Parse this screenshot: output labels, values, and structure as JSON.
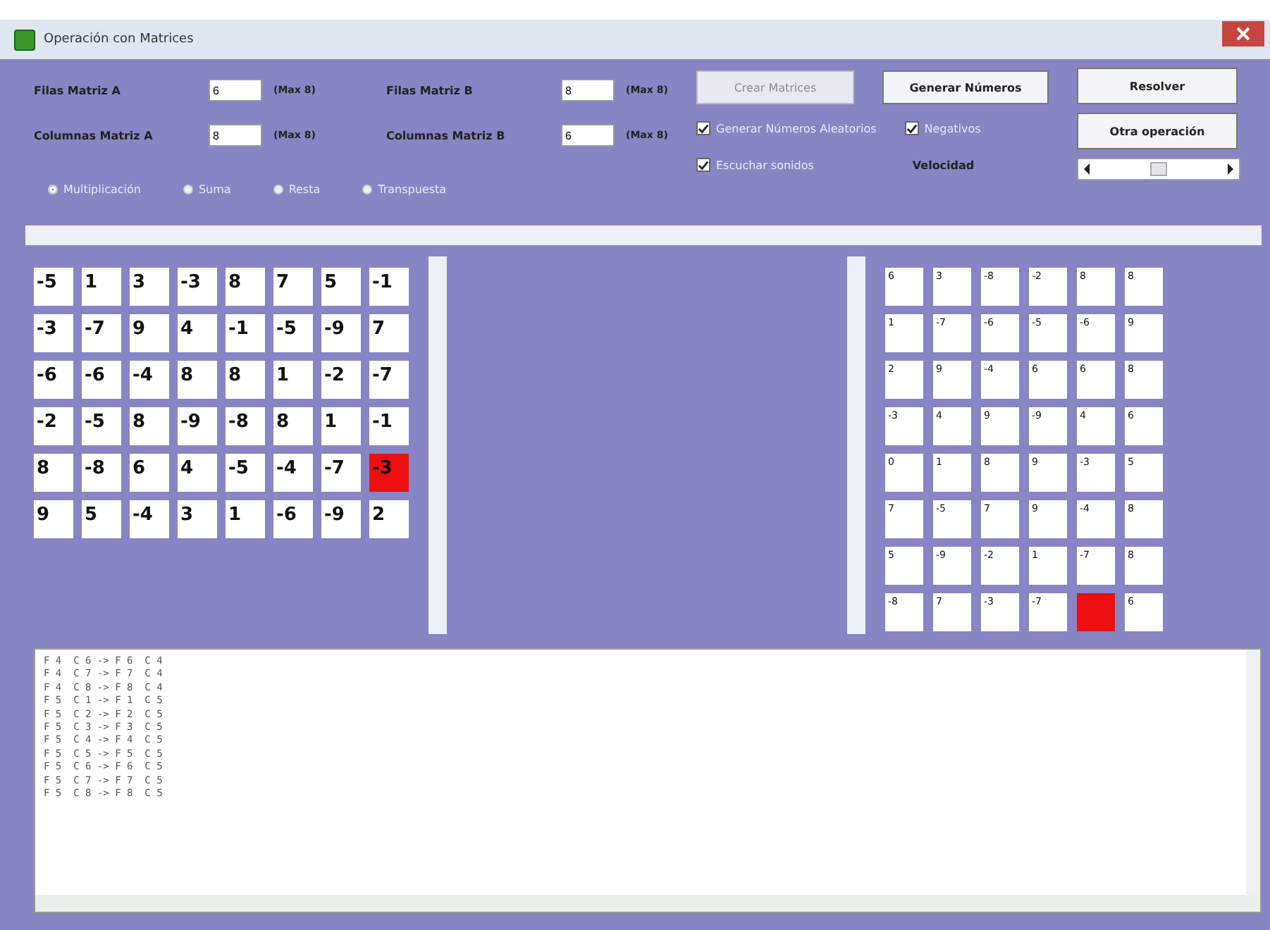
{
  "window": {
    "title": "Operación con Matrices"
  },
  "inputs": [
    {
      "label": "Filas Matriz A",
      "value": "6",
      "hint": "(Max 8)"
    },
    {
      "label": "Columnas Matriz A",
      "value": "8",
      "hint": "(Max 8)"
    },
    {
      "label": "Filas Matriz B",
      "value": "8",
      "hint": "(Max 8)"
    },
    {
      "label": "Columnas Matriz B",
      "value": "6",
      "hint": "(Max 8)"
    }
  ],
  "operations": [
    {
      "label": "Multiplicación",
      "selected": true
    },
    {
      "label": "Suma",
      "selected": false
    },
    {
      "label": "Resta",
      "selected": false
    },
    {
      "label": "Transpuesta",
      "selected": false
    }
  ],
  "buttons": [
    {
      "label": "Crear Matrices",
      "disabled": true
    },
    {
      "label": "Generar Números",
      "disabled": false
    },
    {
      "label": "Resolver",
      "disabled": false
    },
    {
      "label": "Otra operación",
      "disabled": false
    }
  ],
  "checkboxes": [
    {
      "label": "Generar Números Aleatorios",
      "checked": true
    },
    {
      "label": "Negativos",
      "checked": true
    },
    {
      "label": "Escuchar sonidos",
      "checked": true
    }
  ],
  "speed": {
    "label": "Velocidad",
    "level": 0.5
  },
  "matrix_a": [
    [
      {
        "v": "-5"
      },
      {
        "v": "1"
      },
      {
        "v": "3"
      },
      {
        "v": "-3"
      },
      {
        "v": "8"
      },
      {
        "v": "7"
      },
      {
        "v": "5"
      },
      {
        "v": "-1"
      }
    ],
    [
      {
        "v": "-3"
      },
      {
        "v": "-7"
      },
      {
        "v": "9"
      },
      {
        "v": "4"
      },
      {
        "v": "-1"
      },
      {
        "v": "-5"
      },
      {
        "v": "-9"
      },
      {
        "v": "7"
      }
    ],
    [
      {
        "v": "-6"
      },
      {
        "v": "-6"
      },
      {
        "v": "-4"
      },
      {
        "v": "8"
      },
      {
        "v": "8"
      },
      {
        "v": "1"
      },
      {
        "v": "-2"
      },
      {
        "v": "-7"
      }
    ],
    [
      {
        "v": "-2"
      },
      {
        "v": "-5"
      },
      {
        "v": "8"
      },
      {
        "v": "-9"
      },
      {
        "v": "-8"
      },
      {
        "v": "8"
      },
      {
        "v": "1"
      },
      {
        "v": "-1"
      }
    ],
    [
      {
        "v": "8"
      },
      {
        "v": "-8"
      },
      {
        "v": "6"
      },
      {
        "v": "4"
      },
      {
        "v": "-5"
      },
      {
        "v": "-4"
      },
      {
        "v": "-7"
      },
      {
        "v": "-3",
        "highlighted": true
      }
    ],
    [
      {
        "v": "9"
      },
      {
        "v": "5"
      },
      {
        "v": "-4"
      },
      {
        "v": "3"
      },
      {
        "v": "1"
      },
      {
        "v": "-6"
      },
      {
        "v": "-9"
      },
      {
        "v": "2"
      }
    ]
  ],
  "matrix_b": [
    [
      {
        "v": "6"
      },
      {
        "v": "3"
      },
      {
        "v": "-8"
      },
      {
        "v": "-2"
      },
      {
        "v": "8"
      },
      {
        "v": "8"
      }
    ],
    [
      {
        "v": "1"
      },
      {
        "v": "-7"
      },
      {
        "v": "-6"
      },
      {
        "v": "-5"
      },
      {
        "v": "-6"
      },
      {
        "v": "9"
      }
    ],
    [
      {
        "v": "2"
      },
      {
        "v": "9"
      },
      {
        "v": "-4"
      },
      {
        "v": "6"
      },
      {
        "v": "6"
      },
      {
        "v": "8"
      }
    ],
    [
      {
        "v": "-3"
      },
      {
        "v": "4"
      },
      {
        "v": "9"
      },
      {
        "v": "-9"
      },
      {
        "v": "4"
      },
      {
        "v": "6"
      }
    ],
    [
      {
        "v": "0"
      },
      {
        "v": "1"
      },
      {
        "v": "8"
      },
      {
        "v": "9"
      },
      {
        "v": "-3"
      },
      {
        "v": "5"
      }
    ],
    [
      {
        "v": "7"
      },
      {
        "v": "-5"
      },
      {
        "v": "7"
      },
      {
        "v": "9"
      },
      {
        "v": "-4"
      },
      {
        "v": "8"
      }
    ],
    [
      {
        "v": "5"
      },
      {
        "v": "-9"
      },
      {
        "v": "-2"
      },
      {
        "v": "1"
      },
      {
        "v": "-7"
      },
      {
        "v": "8"
      }
    ],
    [
      {
        "v": "-8"
      },
      {
        "v": "7"
      },
      {
        "v": "-3"
      },
      {
        "v": "-7"
      },
      {
        "highlighted": true
      },
      {
        "v": "6"
      }
    ]
  ],
  "log": [
    "F 4  C 6 -> F 6  C 4",
    "F 4  C 7 -> F 7  C 4",
    "F 4  C 8 -> F 8  C 4",
    "F 5  C 1 -> F 1  C 5",
    "F 5  C 2 -> F 2  C 5",
    "F 5  C 3 -> F 3  C 5",
    "F 5  C 4 -> F 4  C 5",
    "F 5  C 5 -> F 5  C 5",
    "F 5  C 6 -> F 6  C 5",
    "F 5  C 7 -> F 7  C 5",
    "F 5  C 8 -> F 8  C 5"
  ]
}
